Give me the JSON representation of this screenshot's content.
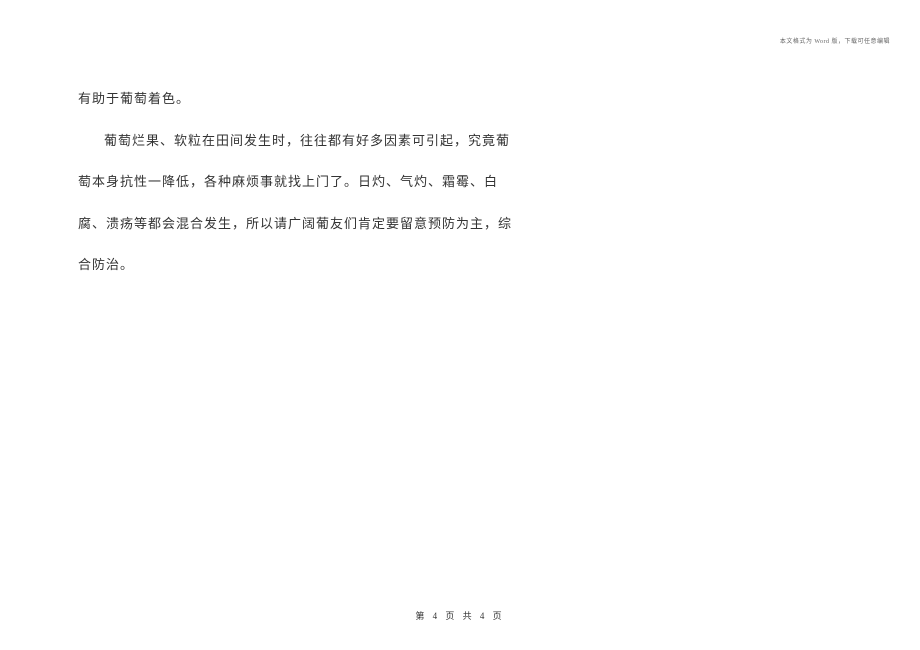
{
  "header": {
    "note": "本文格式为 Word 版，下载可任意编辑"
  },
  "content": {
    "line1": "有助于葡萄着色。",
    "line2": "葡萄烂果、软粒在田间发生时，往往都有好多因素可引起，究竟葡",
    "line3": "萄本身抗性一降低，各种麻烦事就找上门了。日灼、气灼、霜霉、白",
    "line4": "腐、溃疡等都会混合发生，所以请广阔葡友们肯定要留意预防为主，综",
    "line5": "合防治。"
  },
  "footer": {
    "pagination": "第 4 页 共 4 页"
  }
}
